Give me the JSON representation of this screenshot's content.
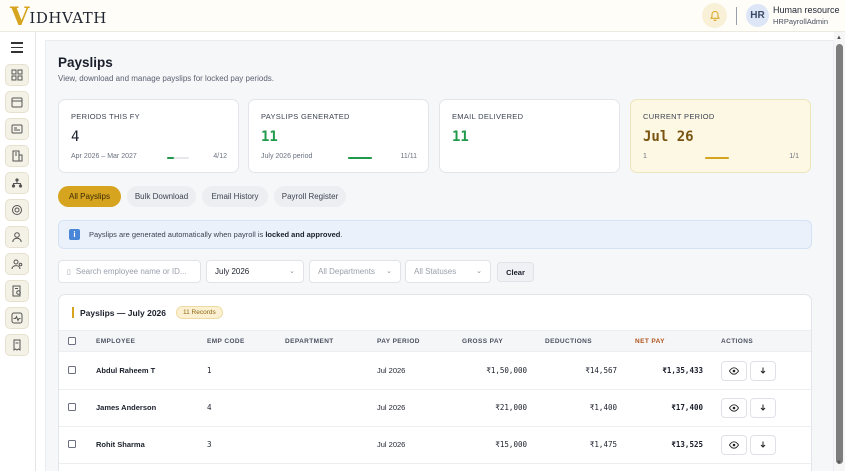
{
  "brand": {
    "logo_v": "V",
    "logo_rest": "IDHVATH"
  },
  "user": {
    "initials": "HR",
    "name": "Human resource",
    "role": "HRPayrollAdmin"
  },
  "sidebar": {
    "icons": [
      "dashboard-icon",
      "calendar-icon",
      "id-card-icon",
      "building-icon",
      "org-chart-icon",
      "payment-icon",
      "user-icon",
      "users-icon",
      "document-search-icon",
      "activity-icon",
      "receipt-icon"
    ]
  },
  "page": {
    "title": "Payslips",
    "subtitle": "View, download and manage payslips for locked pay periods."
  },
  "stats": [
    {
      "label": "PERIODS THIS FY",
      "value": "4",
      "sub": "Apr 2026 – Mar 2027",
      "count": "4/12",
      "progress": 0.33,
      "progress_color": "#1f9a4a"
    },
    {
      "label": "PAYSLIPS GENERATED",
      "value": "11",
      "sub": "July 2026 period",
      "count": "11/11",
      "progress": 1.0,
      "progress_color": "#1f9a4a"
    },
    {
      "label": "EMAIL DELIVERED",
      "value": "11"
    },
    {
      "label": "CURRENT PERIOD",
      "value": "Jul 26",
      "sub": "1",
      "count": "1/1",
      "progress": 1.0,
      "progress_color": "#d6a41e"
    }
  ],
  "tabs": [
    "All Payslips",
    "Bulk Download",
    "Email History",
    "Payroll Register"
  ],
  "info": {
    "prefix": "Payslips are generated automatically when payroll is ",
    "bold": "locked and approved",
    "suffix": "."
  },
  "filters": {
    "search_placeholder": "Search employee name or ID...",
    "period": "July 2026",
    "department": "All Departments",
    "status": "All Statuses",
    "clear_label": "Clear"
  },
  "table": {
    "title": "Payslips — July 2026",
    "badge": "11 Records",
    "headers": [
      "EMPLOYEE",
      "EMP CODE",
      "DEPARTMENT",
      "PAY PERIOD",
      "GROSS PAY",
      "DEDUCTIONS",
      "NET PAY",
      "ACTIONS"
    ],
    "rows": [
      {
        "employee": "Abdul Raheem T",
        "code": "1",
        "department": "",
        "period": "Jul 2026",
        "gross": "₹1,50,000",
        "deductions": "₹14,567",
        "net": "₹1,35,433"
      },
      {
        "employee": "James Anderson",
        "code": "4",
        "department": "",
        "period": "Jul 2026",
        "gross": "₹21,000",
        "deductions": "₹1,400",
        "net": "₹17,400"
      },
      {
        "employee": "Rohit Sharma",
        "code": "3",
        "department": "",
        "period": "Jul 2026",
        "gross": "₹15,000",
        "deductions": "₹1,475",
        "net": "₹13,525"
      }
    ]
  },
  "colors": {
    "accent": "#d6a41e",
    "success": "#1f9a4a",
    "net_pay_header": "#b0521a"
  }
}
